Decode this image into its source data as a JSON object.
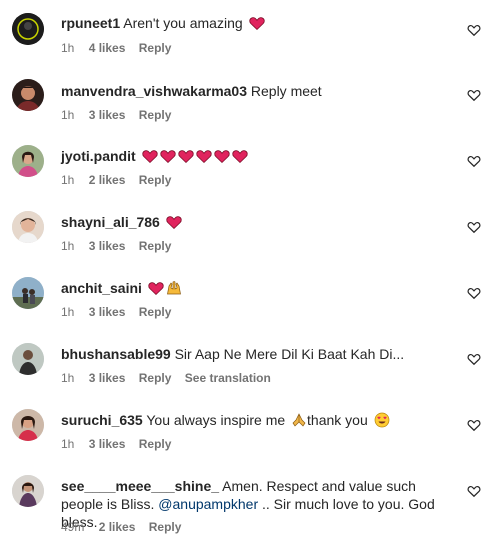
{
  "colors": {
    "username": "#262626",
    "meta": "#737373",
    "mention": "#00376b",
    "heart": "#e0245e"
  },
  "comments": [
    {
      "username": "rpuneet1",
      "text": "Aren't you amazing",
      "emojis": [
        "red-heart"
      ],
      "time": "1h",
      "likes": "4 likes",
      "reply": "Reply",
      "avatar": "dark-avatar"
    },
    {
      "username": "manvendra_vishwakarma03",
      "text": "Reply meet",
      "emojis": [],
      "time": "1h",
      "likes": "3 likes",
      "reply": "Reply",
      "avatar": "person-avatar"
    },
    {
      "username": "jyoti.pandit",
      "text": "",
      "emojis": [
        "red-heart",
        "red-heart",
        "red-heart",
        "red-heart",
        "red-heart",
        "red-heart"
      ],
      "time": "1h",
      "likes": "2 likes",
      "reply": "Reply",
      "avatar": "person-avatar"
    },
    {
      "username": "shayni_ali_786",
      "text": "",
      "emojis": [
        "red-heart"
      ],
      "time": "1h",
      "likes": "3 likes",
      "reply": "Reply",
      "avatar": "person-avatar"
    },
    {
      "username": "anchit_saini",
      "text": "",
      "emojis": [
        "red-heart",
        "raised-hands"
      ],
      "time": "1h",
      "likes": "3 likes",
      "reply": "Reply",
      "avatar": "outdoor-avatar"
    },
    {
      "username": "bhushansable99",
      "text": "Sir Aap Ne Mere Dil Ki Baat Kah Di...",
      "emojis": [],
      "time": "1h",
      "likes": "3 likes",
      "reply": "Reply",
      "translation": "See translation",
      "avatar": "person-avatar"
    },
    {
      "username": "suruchi_635",
      "text": "You always inspire me",
      "text2": "thank you",
      "emojis": [
        "folded-hands"
      ],
      "emojis2": [
        "heart-eyes"
      ],
      "time": "1h",
      "likes": "3 likes",
      "reply": "Reply",
      "avatar": "person-avatar"
    },
    {
      "username": "see____meee___shine_",
      "text": "Amen. Respect and value such people is Bliss.",
      "mention": "@anupampkher",
      "text_after_mention": ".. Sir much love to you. God bless.",
      "emojis": [],
      "time": "49m",
      "likes": "2 likes",
      "reply": "Reply",
      "avatar": "person-avatar"
    }
  ]
}
